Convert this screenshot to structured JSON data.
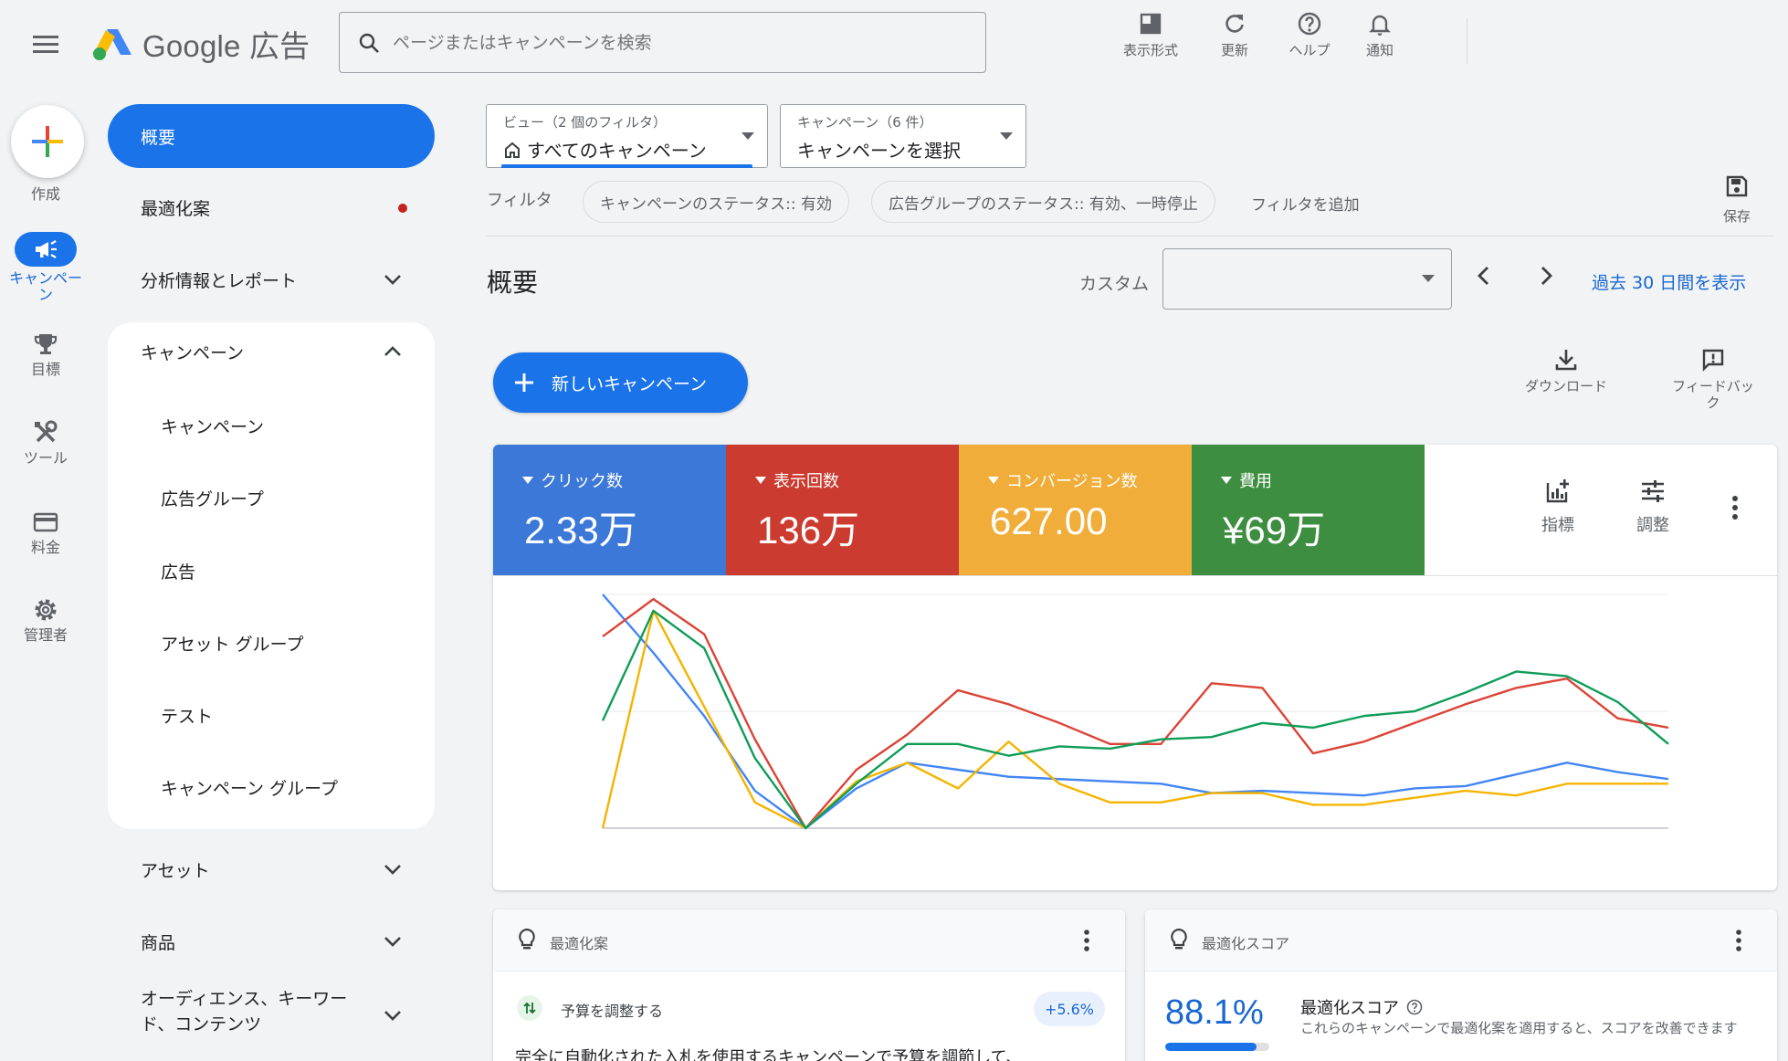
{
  "header": {
    "logo_text": "Google 広告",
    "search_placeholder": "ページまたはキャンペーンを検索",
    "tools": [
      {
        "label": "表示形式",
        "icon": "appearance-icon"
      },
      {
        "label": "更新",
        "icon": "refresh-icon"
      },
      {
        "label": "ヘルプ",
        "icon": "help-icon"
      },
      {
        "label": "通知",
        "icon": "bell-icon"
      }
    ]
  },
  "rail": {
    "create_label": "作成",
    "items": [
      {
        "label": "キャンペーン",
        "icon": "megaphone-icon",
        "active": true
      },
      {
        "label": "目標",
        "icon": "trophy-icon"
      },
      {
        "label": "ツール",
        "icon": "tools-icon"
      },
      {
        "label": "料金",
        "icon": "credit-card-icon"
      },
      {
        "label": "管理者",
        "icon": "gear-icon"
      }
    ]
  },
  "sidenav": {
    "overview": "概要",
    "recommendations": "最適化案",
    "insights": "分析情報とレポート",
    "campaigns_group": "キャンペーン",
    "sub_items": [
      "キャンペーン",
      "広告グループ",
      "広告",
      "アセット グループ",
      "テスト",
      "キャンペーン グループ"
    ],
    "assets": "アセット",
    "products": "商品",
    "audiences": "オーディエンス、キーワード、コンテンツ"
  },
  "view_dropdown": {
    "label": "ビュー（2 個のフィルタ）",
    "value": "すべてのキャンペーン"
  },
  "campaign_dropdown": {
    "label": "キャンペーン（6 件）",
    "value": "キャンペーンを選択"
  },
  "filters": {
    "label": "フィルタ",
    "chips": [
      "キャンペーンのステータス:: 有効",
      "広告グループのステータス:: 有効、一時停止"
    ],
    "add": "フィルタを追加",
    "save": "保存"
  },
  "page": {
    "title": "概要",
    "custom_label": "カスタム",
    "date_value": "",
    "range_link": "過去 30 日間を表示",
    "new_campaign": "新しいキャンペーン",
    "download": "ダウンロード",
    "feedback": "フィードバック"
  },
  "metrics": [
    {
      "label": "クリック数",
      "value": "2.33万",
      "color": "#3c78d8"
    },
    {
      "label": "表示回数",
      "value": "136万",
      "color": "#cc3b2f"
    },
    {
      "label": "コンバージョン数",
      "value": "627.00",
      "color": "#f1ad3a"
    },
    {
      "label": "費用",
      "value": "¥69万",
      "color": "#3e8e41"
    }
  ],
  "chart_tools": {
    "metrics": "指標",
    "adjust": "調整"
  },
  "chart_data": {
    "type": "line",
    "x": [
      0,
      1,
      2,
      3,
      4,
      5,
      6,
      7,
      8,
      9,
      10,
      11,
      12,
      13,
      14,
      15,
      16,
      17,
      18,
      19,
      20,
      21
    ],
    "ylim": [
      0,
      100
    ],
    "series": [
      {
        "color": "#4285f4",
        "values": [
          100,
          75,
          48,
          16,
          0,
          17,
          28,
          25,
          22,
          21,
          20,
          19,
          15,
          16,
          15,
          14,
          17,
          18,
          23,
          28,
          24,
          21
        ]
      },
      {
        "color": "#db4437",
        "values": [
          82,
          98,
          83,
          38,
          0,
          25,
          40,
          59,
          53,
          45,
          36,
          36,
          62,
          60,
          32,
          37,
          45,
          53,
          60,
          64,
          47,
          43
        ]
      },
      {
        "color": "#f4b400",
        "values": [
          0,
          93,
          52,
          11,
          0,
          20,
          28,
          17,
          37,
          19,
          11,
          11,
          15,
          15,
          10,
          10,
          13,
          16,
          14,
          19,
          19,
          19
        ]
      },
      {
        "color": "#0f9d58",
        "values": [
          46,
          93,
          77,
          30,
          0,
          19,
          36,
          36,
          31,
          35,
          34,
          38,
          39,
          45,
          43,
          48,
          50,
          58,
          67,
          65,
          54,
          36
        ]
      }
    ]
  },
  "recommendations_card": {
    "title": "最適化案",
    "item_title": "予算を調整する",
    "item_badge": "+5.6%",
    "item_text": "完全に自動化された入札を使用するキャンペーンで予算を調節して、"
  },
  "score_card": {
    "title": "最適化スコア",
    "score": "88.1%",
    "score_fraction": 0.881,
    "heading": "最適化スコア",
    "description": "これらのキャンペーンで最適化案を適用すると、スコアを改善できます"
  },
  "colors": {
    "brand_blue": "#1a73e8",
    "link_blue": "#1967d2"
  }
}
